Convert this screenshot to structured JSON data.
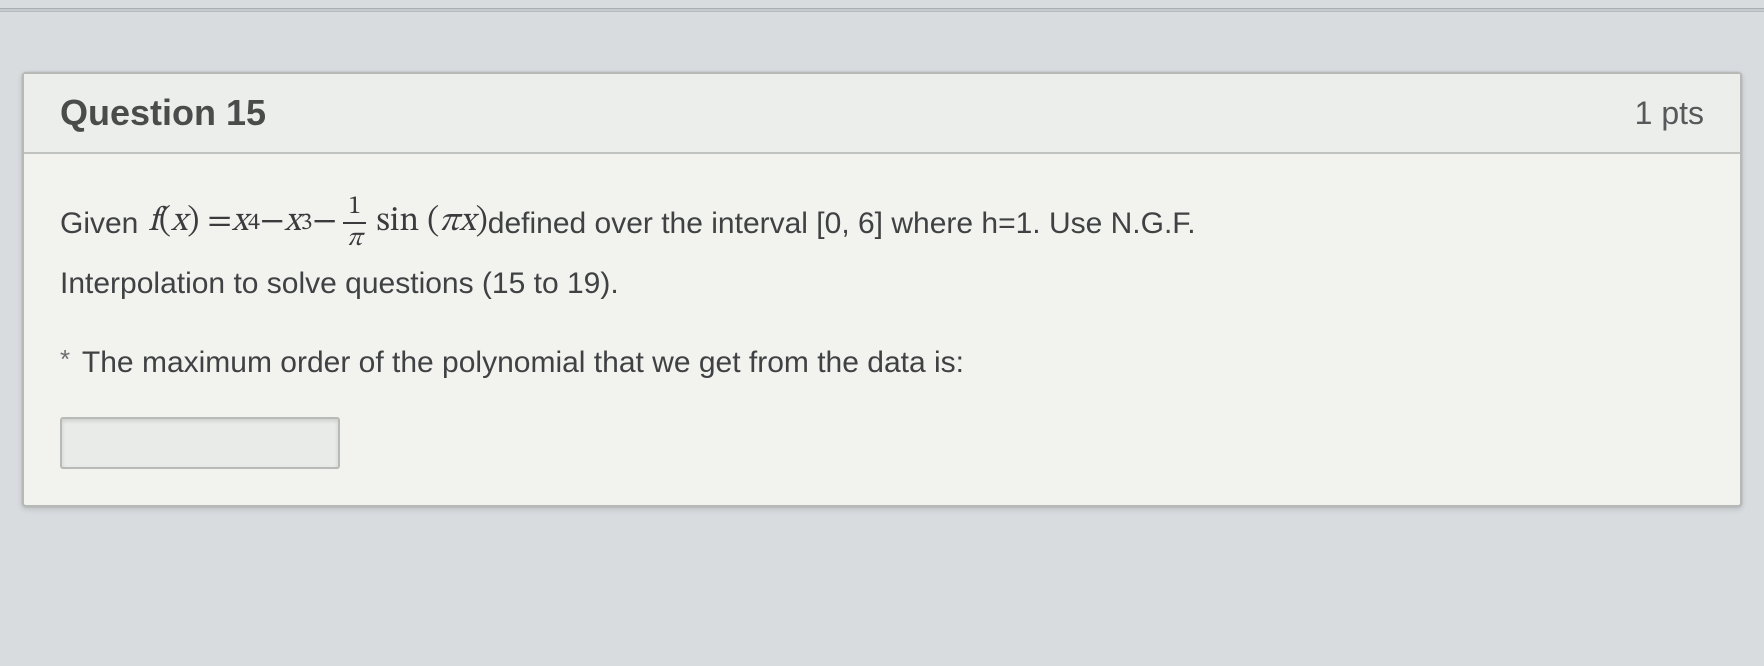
{
  "header": {
    "title": "Question 15",
    "points": "1 pts"
  },
  "body": {
    "given_label": "Given",
    "func_lhs_f": "f",
    "func_lhs_open": " (",
    "func_lhs_x": "x",
    "func_lhs_close": ") = ",
    "term1_base": "x",
    "term1_exp": "4",
    "minus1": " − ",
    "term2_base": "x",
    "term2_exp": "3",
    "minus2": " − ",
    "frac_num": "1",
    "frac_den": "π",
    "sin_label": " sin (",
    "sin_arg_pi": "π",
    "sin_arg_x": "x",
    "sin_close": ")",
    "after_math_1": " defined over the interval [0, 6] where h=1. Use N.G.F.",
    "line2": "Interpolation to solve questions (15 to 19).",
    "required_mark": "*",
    "prompt": " The maximum order of the polynomial that we get from the data is:",
    "answer_value": ""
  }
}
